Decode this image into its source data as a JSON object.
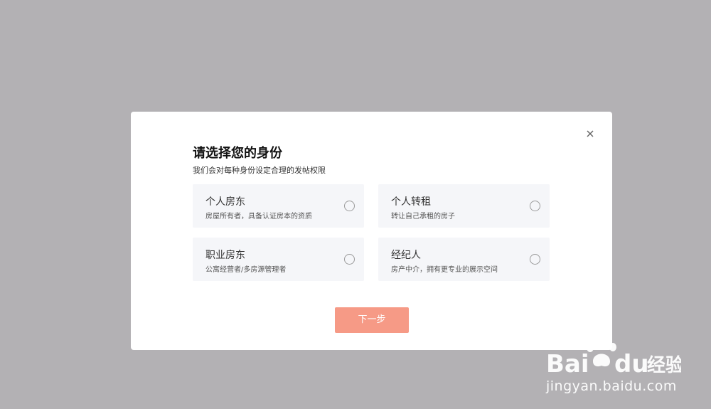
{
  "dialog": {
    "title": "请选择您的身份",
    "subtitle": "我们会对每种身份设定合理的发帖权限",
    "close_icon": "close-icon",
    "options": [
      {
        "label": "个人房东",
        "description": "房屋所有者，具备认证房本的资质",
        "selected": false
      },
      {
        "label": "个人转租",
        "description": "转让自己承租的房子",
        "selected": false
      },
      {
        "label": "职业房东",
        "description": "公寓经营者/多房源管理者",
        "selected": false
      },
      {
        "label": "经纪人",
        "description": "房产中介，拥有更专业的展示空间",
        "selected": false
      }
    ],
    "next_button_label": "下一步"
  },
  "watermark": {
    "logo_text": "Bai du 经验",
    "url": "jingyan.baidu.com"
  },
  "colors": {
    "overlay": "#b3b1b4",
    "modal_bg": "#ffffff",
    "option_bg": "#f5f6f9",
    "primary_button": "#f69a86",
    "title_text": "#111111"
  }
}
